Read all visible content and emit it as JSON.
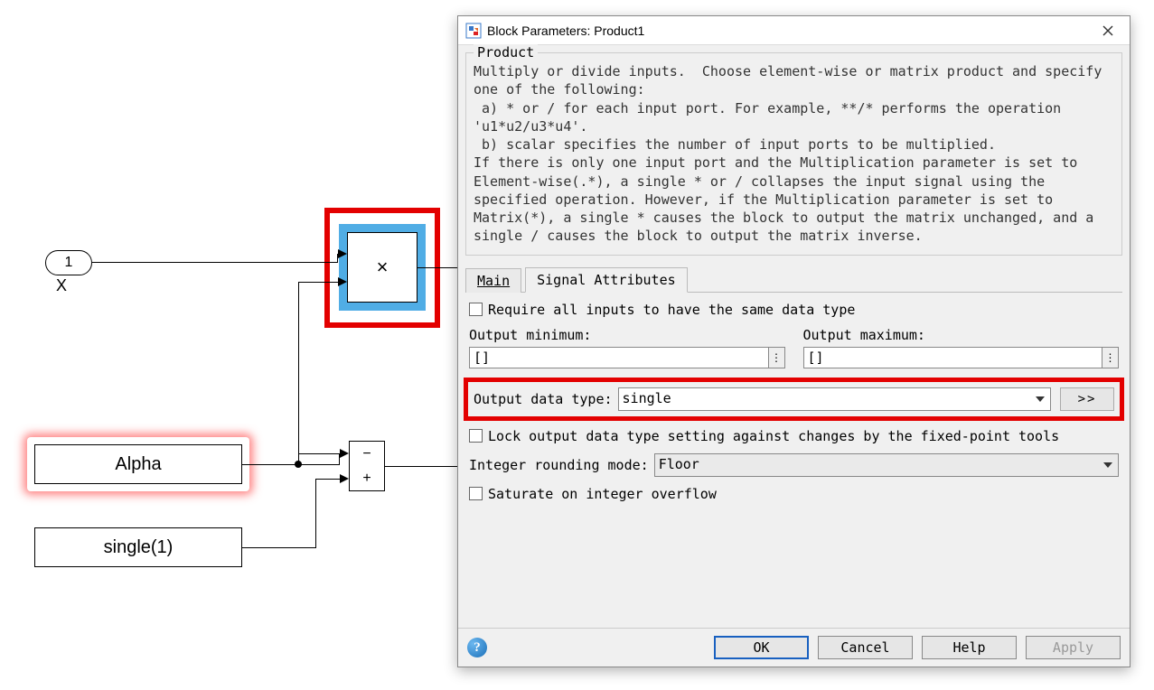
{
  "diagram": {
    "port": {
      "value": "1",
      "label": "X"
    },
    "alpha_label": "Alpha",
    "single_label": "single(1)",
    "product_symbol": "×",
    "sum_minus": "−",
    "sum_plus": "+"
  },
  "dialog": {
    "title": "Block Parameters: Product1",
    "group_title": "Product",
    "description": "Multiply or divide inputs.  Choose element-wise or matrix product and specify one of the following:\n a) * or / for each input port. For example, **/* performs the operation 'u1*u2/u3*u4'.\n b) scalar specifies the number of input ports to be multiplied.\nIf there is only one input port and the Multiplication parameter is set to Element-wise(.*), a single * or / collapses the input signal using the specified operation. However, if the Multiplication parameter is set to Matrix(*), a single * causes the block to output the matrix unchanged, and a single / causes the block to output the matrix inverse.",
    "tabs": {
      "main": "Main",
      "signal": "Signal Attributes",
      "active": "signal"
    },
    "fields": {
      "require_same_type": {
        "label": "Require all inputs to have the same data type",
        "checked": false
      },
      "output_min_label": "Output minimum:",
      "output_min_value": "[]",
      "output_max_label": "Output maximum:",
      "output_max_value": "[]",
      "output_data_type_label": "Output data type:",
      "output_data_type_value": "single",
      "more_label": ">>",
      "lock_label": "Lock output data type setting against changes by the fixed-point tools",
      "lock_checked": false,
      "rounding_label": "Integer rounding mode:",
      "rounding_value": "Floor",
      "saturate_label": "Saturate on integer overflow",
      "saturate_checked": false
    },
    "buttons": {
      "ok": "OK",
      "cancel": "Cancel",
      "help": "Help",
      "apply": "Apply"
    },
    "help_tip": "?"
  }
}
